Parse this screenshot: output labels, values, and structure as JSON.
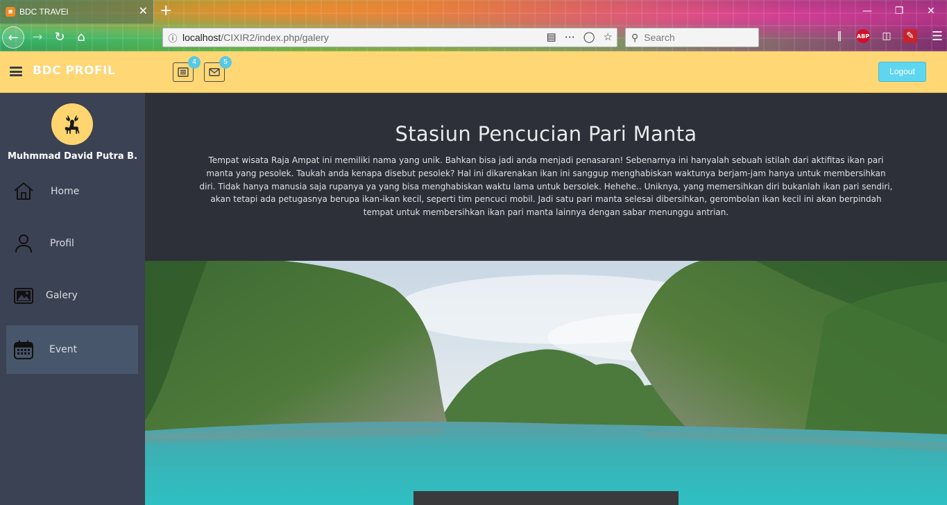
{
  "browser": {
    "tab_title": "BDC TRAVEl",
    "tab_favicon": "BDC",
    "url_host": "localhost",
    "url_path": "/CIXIR2/index.php/galery",
    "search_placeholder": "Search"
  },
  "header": {
    "brand": "BDC PROFIL",
    "tasks_badge": "4",
    "messages_badge": "5",
    "logout_label": "Logout"
  },
  "sidebar": {
    "user_name": "Muhmmad David Putra B.",
    "items": [
      {
        "label": "Home",
        "icon": "home-icon"
      },
      {
        "label": "Profil",
        "icon": "user-icon"
      },
      {
        "label": "Galery",
        "icon": "image-icon"
      },
      {
        "label": "Event",
        "icon": "calendar-icon",
        "active": true
      }
    ]
  },
  "content": {
    "title": "Stasiun Pencucian Pari Manta",
    "paragraph": "Tempat wisata Raja Ampat ini memiliki nama yang unik. Bahkan bisa jadi anda menjadi penasaran! Sebenarnya ini hanyalah sebuah istilah dari aktifitas ikan pari manta yang pesolek. Taukah anda kenapa disebut pesolek? Hal ini dikarenakan ikan ini sanggup menghabiskan waktunya berjam-jam hanya untuk membersihkan diri. Tidak hanya manusia saja rupanya ya yang bisa menghabiskan waktu lama untuk bersolek. Hehehe.. Uniknya, yang memersihkan diri bukanlah ikan pari sendiri, akan tetapi ada petugasnya berupa ikan-ikan kecil, seperti tim pencuci mobil. Jadi satu pari manta selesai dibersihkan, gerombolan ikan kecil ini akan berpindah tempat untuk membersihkan ikan pari manta lainnya dengan sabar menunggu antrian."
  },
  "colors": {
    "header_bg": "#ffd875",
    "sidebar_bg": "#3b4253",
    "main_bg": "#2d3038",
    "logout_bg": "#5fd6ef",
    "badge_bg": "#5bc8e2"
  }
}
